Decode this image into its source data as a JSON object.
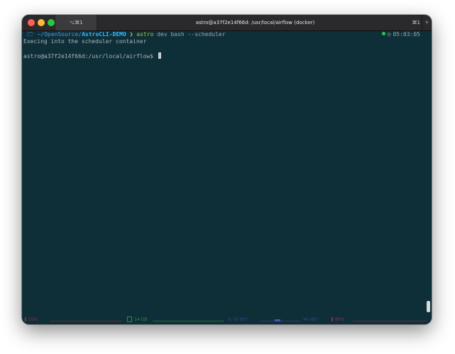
{
  "window": {
    "tab_shortcut_left": "⌥⌘1",
    "title": "astro@a37f2e14f66d: /usr/local/airflow (docker)",
    "tab_shortcut_right": "⌘1",
    "new_tab": "+"
  },
  "prompt": {
    "path_home": "~/OpenSource/",
    "path_dir": "AstroCLI-DEMO",
    "arrow": "❯",
    "cmd_name": "astro",
    "cmd_args": " dev bash --scheduler",
    "time": "05:03:05"
  },
  "output": {
    "line1": "Execing into the scheduler container",
    "shell_prompt": "astro@a37f2e14f66d:/usr/local/airflow$ "
  },
  "status": {
    "cpu": "25%",
    "memory": "14 GB",
    "net_up": "19 kB↑",
    "net_down": "46 kB↑",
    "battery": "80%"
  },
  "colors": {
    "terminal_bg": "#0f2f38",
    "path_color": "#39b8ff",
    "command_color": "#a9c13a",
    "arrow_color": "#d9c34a"
  }
}
